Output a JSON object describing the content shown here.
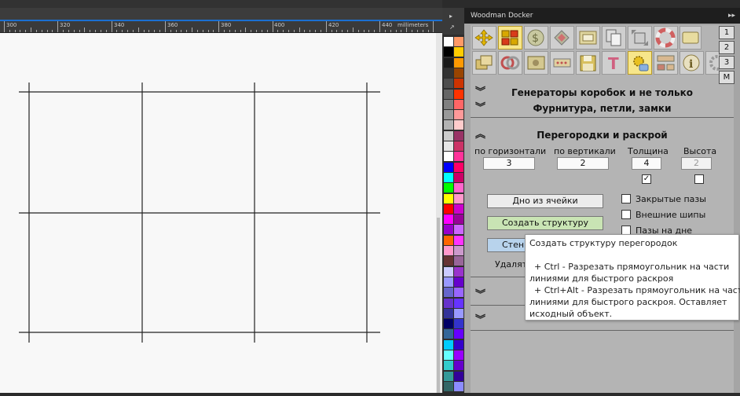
{
  "ruler": {
    "labels": [
      "300",
      "320",
      "340",
      "360",
      "380",
      "400",
      "420",
      "440"
    ],
    "unit": "millimeters"
  },
  "docker": {
    "title": "Woodman Docker",
    "side_tabs": [
      "1",
      "2",
      "3",
      "M"
    ],
    "toolbar_icons": [
      "move-arrows-icon",
      "grid-blocks-icon",
      "dollar-coin-icon",
      "puzzle-pieces-icon",
      "frame-box-icon",
      "copy-documents-icon",
      "resize-arrows-icon",
      "lifebuoy-icon",
      "panel-box-icon",
      "stack-layers-icon",
      "dual-ring-icon",
      "photo-frame-icon",
      "ruler-dots-icon",
      "floppy-save-icon",
      "text-t-icon",
      "gear-hand-icon",
      "component-blocks-icon",
      "info-circle-icon",
      "settings-gear-icon"
    ]
  },
  "sections": {
    "generators": "Генераторы коробок и не только",
    "hardware": "Фурнитура, петли, замки",
    "partitions": "Перегородки и раскрой"
  },
  "partitions": {
    "horizontal_label": "по горизонтали",
    "horizontal_value": "3",
    "vertical_label": "по вертикали",
    "vertical_value": "2",
    "thickness_label": "Толщина",
    "thickness_value": "4",
    "height_label": "Высота",
    "height_value": "2",
    "thickness_checked": true,
    "height_checked": false,
    "bottom_button": "Дно из ячейки",
    "create_button": "Создать структуру",
    "walls_button": "Стенк",
    "delete_label": "Удалят",
    "closed_slots": "Закрытые пазы",
    "outer_tenons": "Внешние шипы",
    "bottom_slots": "Пазы на дне"
  },
  "tooltip": {
    "line1": "Создать структуру перегородок",
    "line2": "+ Ctrl - Разрезать прямоугольник на части",
    "line3": "линиями для быстрого раскроя",
    "line4": "+ Ctrl+Alt - Разрезать прямоугольник на части",
    "line5": "линиями для быстрого раскроя. Оставляет",
    "line6": "исходный объект."
  },
  "palette": {
    "left": [
      "#ffffff",
      "#000000",
      "#1a1a1a",
      "#333333",
      "#4d4d4d",
      "#666666",
      "#808080",
      "#999999",
      "#b3b3b3",
      "#cccccc",
      "#e6e6e6",
      "#ffffff",
      "#0000ff",
      "#00ffff",
      "#00ff00",
      "#ffff00",
      "#ff0000",
      "#ff00ff",
      "#9900cc",
      "#ff6600",
      "#ff99cc",
      "#663333",
      "#ccccff",
      "#9999ff",
      "#6666cc",
      "#6633cc",
      "#333399",
      "#000066",
      "#336699",
      "#00ccff",
      "#66ffff",
      "#33cccc",
      "#339999",
      "#336666"
    ],
    "right": [
      "#ff9966",
      "#ffcc00",
      "#ff9900",
      "#994400",
      "#cc3300",
      "#ff3300",
      "#ff6666",
      "#ff9999",
      "#ffcccc",
      "#993366",
      "#cc3366",
      "#ff3399",
      "#ff0066",
      "#cc0066",
      "#ff66cc",
      "#ff99cc",
      "#cc00cc",
      "#990099",
      "#cc66ff",
      "#ff33ff",
      "#cc99cc",
      "#996699",
      "#9933cc",
      "#6600cc",
      "#9966ff",
      "#6633ff",
      "#9999ff",
      "#3333cc",
      "#6600ff",
      "#3300cc",
      "#9900ff",
      "#6600cc",
      "#330099",
      "#8c8cff"
    ]
  }
}
